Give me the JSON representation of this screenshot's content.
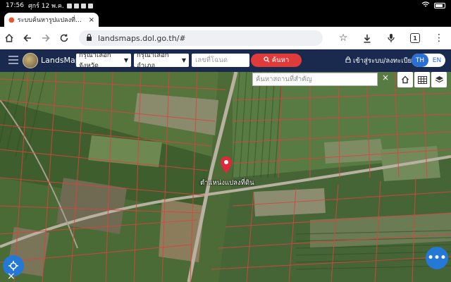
{
  "status_bar": {
    "time": "17:56",
    "date": "ศุกร์ 12 พ.ค.",
    "battery": "battery-icon",
    "wifi": "wifi-icon"
  },
  "browser": {
    "tab": {
      "title": "ระบบค้นหารูปแปลงที่ดิน (Lands",
      "close": "×",
      "icon": "map-pin-icon"
    },
    "new_tab": "+",
    "url": "landsmaps.dol.go.th/#",
    "tab_count": "1"
  },
  "app": {
    "brand": "LandsMaps",
    "province_select": "กรุณาเลือกจังหวัด",
    "district_select": "กรุณาเลือกอำเภอ",
    "deed_placeholder": "เลขที่โฉนด",
    "search_button": "ค้นหา",
    "login": "เข้าสู่ระบบ/ลงทะเบียน",
    "lang_th": "TH",
    "lang_en": "EN"
  },
  "map": {
    "place_search_placeholder": "ค้นหาสถานที่สำคัญ",
    "close": "×",
    "parcel_label": "ตำแหน่งแปลงที่ดิน",
    "fab_more": "•••",
    "fab_close": "×",
    "parcel_line_color": "#d8453f",
    "road_color": "#b8b0a0"
  }
}
